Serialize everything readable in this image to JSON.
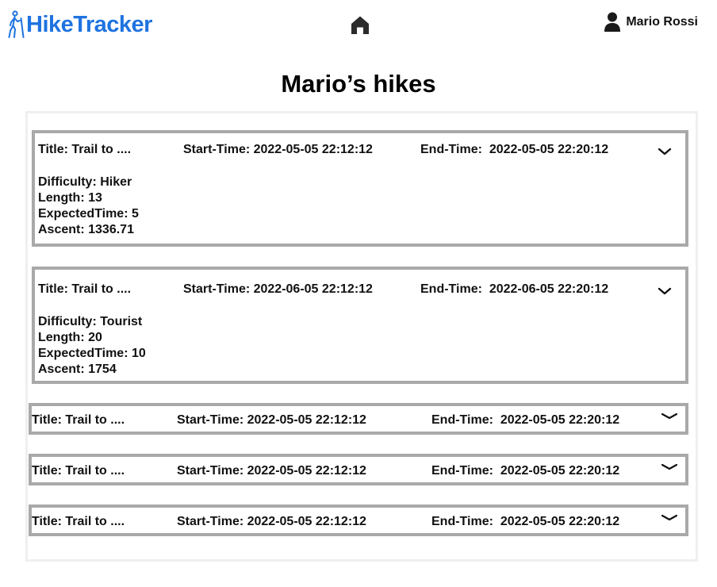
{
  "app": {
    "name": "HikeTracker",
    "brand_color": "#1f73e0"
  },
  "header": {
    "home_icon": "home-icon",
    "user_icon": "user-icon",
    "user_name": "Mario Rossi"
  },
  "page": {
    "title": "Mario’s hikes"
  },
  "hikes": [
    {
      "title": "Title: Trail to ....",
      "start": "Start-Time: 2022-05-05 22:12:12",
      "end": "End-Time:  2022-05-05 22:20:12",
      "expanded": true,
      "difficulty": "Difficulty:  Hiker",
      "length": "Length: 13",
      "expected_time": "ExpectedTime: 5",
      "ascent": "Ascent: 1336.71"
    },
    {
      "title": "Title: Trail to ....",
      "start": "Start-Time: 2022-06-05 22:12:12",
      "end": "End-Time:  2022-06-05 22:20:12",
      "expanded": true,
      "difficulty": "Difficulty:  Tourist",
      "length": "Length: 20",
      "expected_time": "ExpectedTime: 10",
      "ascent": "Ascent: 1754"
    },
    {
      "title": "Title: Trail to ....",
      "start": "Start-Time: 2022-05-05 22:12:12",
      "end": "End-Time:  2022-05-05 22:20:12",
      "expanded": false
    },
    {
      "title": "Title: Trail to ....",
      "start": "Start-Time: 2022-05-05 22:12:12",
      "end": "End-Time:  2022-05-05 22:20:12",
      "expanded": false
    },
    {
      "title": "Title: Trail to ....",
      "start": "Start-Time: 2022-05-05 22:12:12",
      "end": "End-Time:  2022-05-05 22:20:12",
      "expanded": false
    }
  ],
  "icons": {
    "expand": "chevron-down-icon",
    "logo": "hiker-icon"
  }
}
